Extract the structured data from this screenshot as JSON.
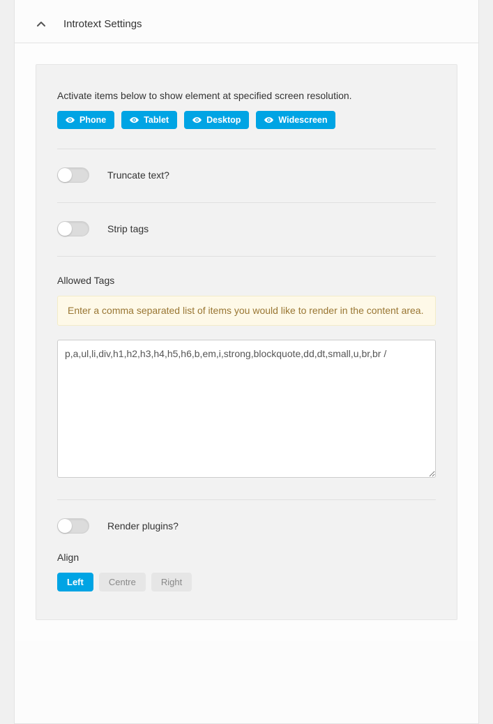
{
  "section": {
    "title": "Introtext Settings"
  },
  "resolution": {
    "hint": "Activate items below to show element at specified screen resolution.",
    "buttons": {
      "phone": "Phone",
      "tablet": "Tablet",
      "desktop": "Desktop",
      "widescreen": "Widescreen"
    }
  },
  "toggles": {
    "truncate": "Truncate text?",
    "strip": "Strip tags",
    "render": "Render plugins?"
  },
  "allowedTags": {
    "label": "Allowed Tags",
    "help": "Enter a comma separated list of items you would like to render in the content area.",
    "value": "p,a,ul,li,div,h1,h2,h3,h4,h5,h6,b,em,i,strong,blockquote,dd,dt,small,u,br,br /"
  },
  "align": {
    "label": "Align",
    "options": {
      "left": "Left",
      "centre": "Centre",
      "right": "Right"
    }
  }
}
